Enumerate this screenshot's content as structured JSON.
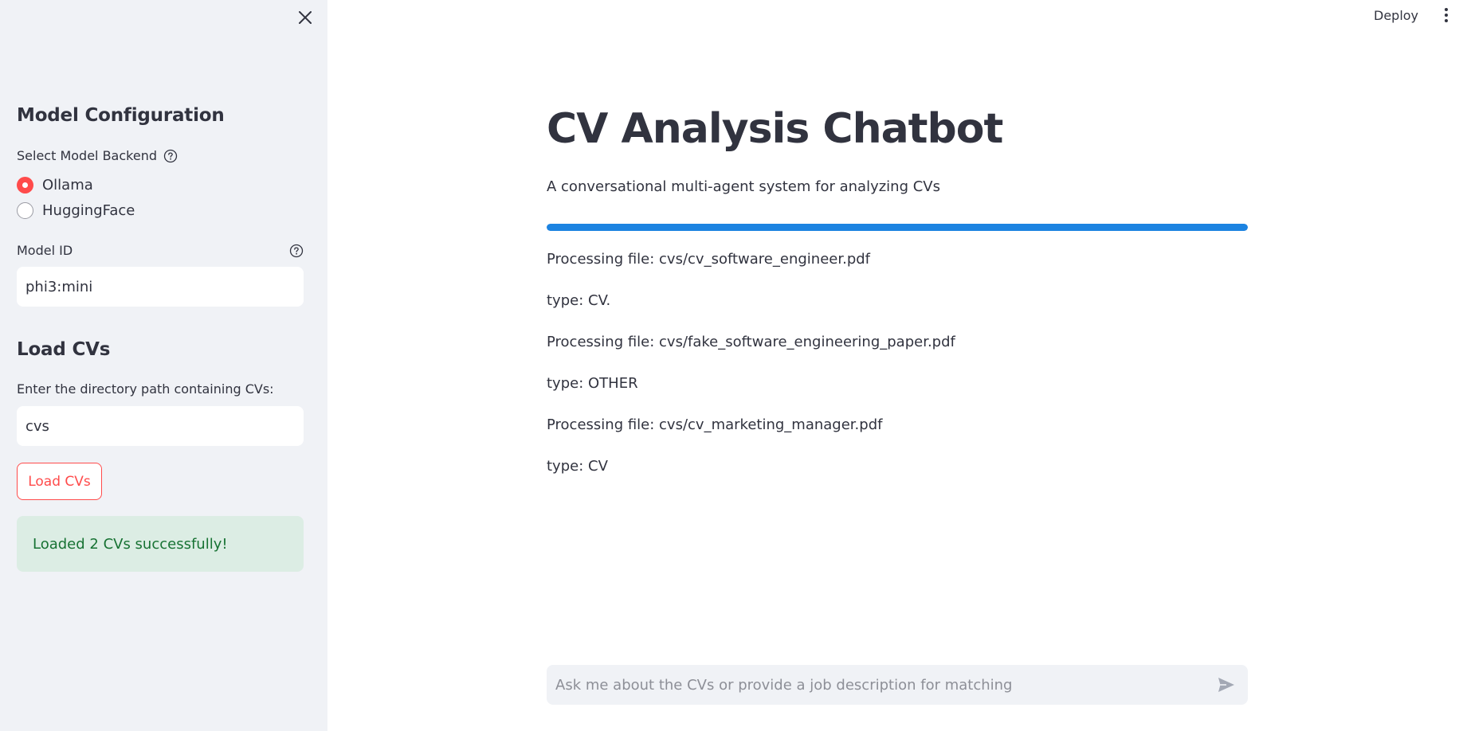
{
  "header": {
    "deploy_label": "Deploy",
    "menu_icon": "more-vert-icon"
  },
  "sidebar": {
    "close_icon": "close-icon",
    "model_section": {
      "heading": "Model Configuration",
      "backend_label": "Select Model Backend",
      "backend_options": [
        {
          "label": "Ollama",
          "selected": true
        },
        {
          "label": "HuggingFace",
          "selected": false
        }
      ],
      "model_id_label": "Model ID",
      "model_id_value": "phi3:mini"
    },
    "load_section": {
      "heading": "Load CVs",
      "dir_label": "Enter the directory path containing CVs:",
      "dir_value": "cvs",
      "load_button_label": "Load CVs",
      "success_message": "Loaded 2 CVs successfully!"
    }
  },
  "main": {
    "title": "CV Analysis Chatbot",
    "subtitle": "A conversational multi-agent system for analyzing CVs",
    "progress": 1.0,
    "log": [
      "Processing file: cvs/cv_software_engineer.pdf",
      "type: CV.",
      "Processing file: cvs/fake_software_engineering_paper.pdf",
      "type: OTHER",
      "Processing file: cvs/cv_marketing_manager.pdf",
      "type: CV"
    ]
  },
  "chat": {
    "placeholder": "Ask me about the CVs or provide a job description for matching",
    "send_icon": "send-icon"
  },
  "colors": {
    "primary": "#ff4b4b",
    "progress": "#1c83e1",
    "success_bg": "#dcede4",
    "success_text": "#177233",
    "sidebar_bg": "#f0f2f6"
  }
}
